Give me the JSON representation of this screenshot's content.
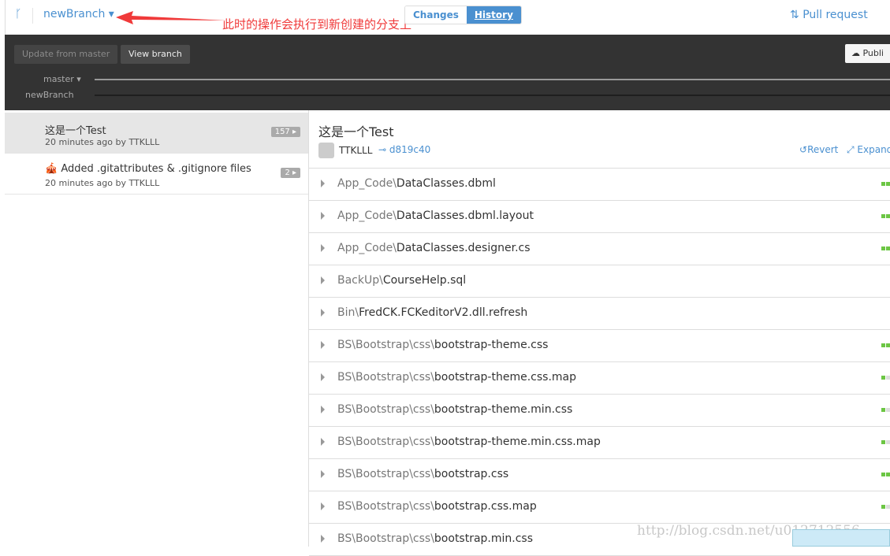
{
  "header": {
    "branch": "newBranch ▾",
    "annotation": "此时的操作会执行到新创建的分支上",
    "tabs": [
      {
        "label": "Changes"
      },
      {
        "label": "History"
      }
    ],
    "pull_request": "Pull request"
  },
  "toolbar": {
    "update": "Update from master",
    "view": "View branch",
    "publish": "Publi"
  },
  "graph": {
    "master": "master ▾",
    "newbranch": "newBranch"
  },
  "commits": [
    {
      "title": "这是一个Test",
      "meta": "20 minutes ago by TTKLLL",
      "count": "157 ▸"
    },
    {
      "title": "🎪 Added .gitattributes & .gitignore files",
      "meta": "20 minutes ago by TTKLLL",
      "count": "2 ▸"
    }
  ],
  "detail": {
    "title": "这是一个Test",
    "author": "TTKLLL",
    "sha": "d819c40",
    "revert": "Revert",
    "expand": "Expand"
  },
  "files": [
    {
      "dir": "App_Code\\",
      "name": "DataClasses.dbml",
      "bars": 2
    },
    {
      "dir": "App_Code\\",
      "name": "DataClasses.dbml.layout",
      "bars": 2
    },
    {
      "dir": "App_Code\\",
      "name": "DataClasses.designer.cs",
      "bars": 2
    },
    {
      "dir": "BackUp\\",
      "name": "CourseHelp.sql",
      "bars": 0
    },
    {
      "dir": "Bin\\",
      "name": "FredCK.FCKeditorV2.dll.refresh",
      "bars": 0
    },
    {
      "dir": "BS\\Bootstrap\\css\\",
      "name": "bootstrap-theme.css",
      "bars": 2
    },
    {
      "dir": "BS\\Bootstrap\\css\\",
      "name": "bootstrap-theme.css.map",
      "bars": 1
    },
    {
      "dir": "BS\\Bootstrap\\css\\",
      "name": "bootstrap-theme.min.css",
      "bars": 1
    },
    {
      "dir": "BS\\Bootstrap\\css\\",
      "name": "bootstrap-theme.min.css.map",
      "bars": 1
    },
    {
      "dir": "BS\\Bootstrap\\css\\",
      "name": "bootstrap.css",
      "bars": 2
    },
    {
      "dir": "BS\\Bootstrap\\css\\",
      "name": "bootstrap.css.map",
      "bars": 1
    },
    {
      "dir": "BS\\Bootstrap\\css\\",
      "name": "bootstrap.min.css",
      "bars": 0
    }
  ],
  "watermark": "http://blog.csdn.net/u012712556",
  "colors": {
    "accent": "#4a90d0",
    "added": "#6cc644",
    "annotation": "#f03a3a"
  }
}
